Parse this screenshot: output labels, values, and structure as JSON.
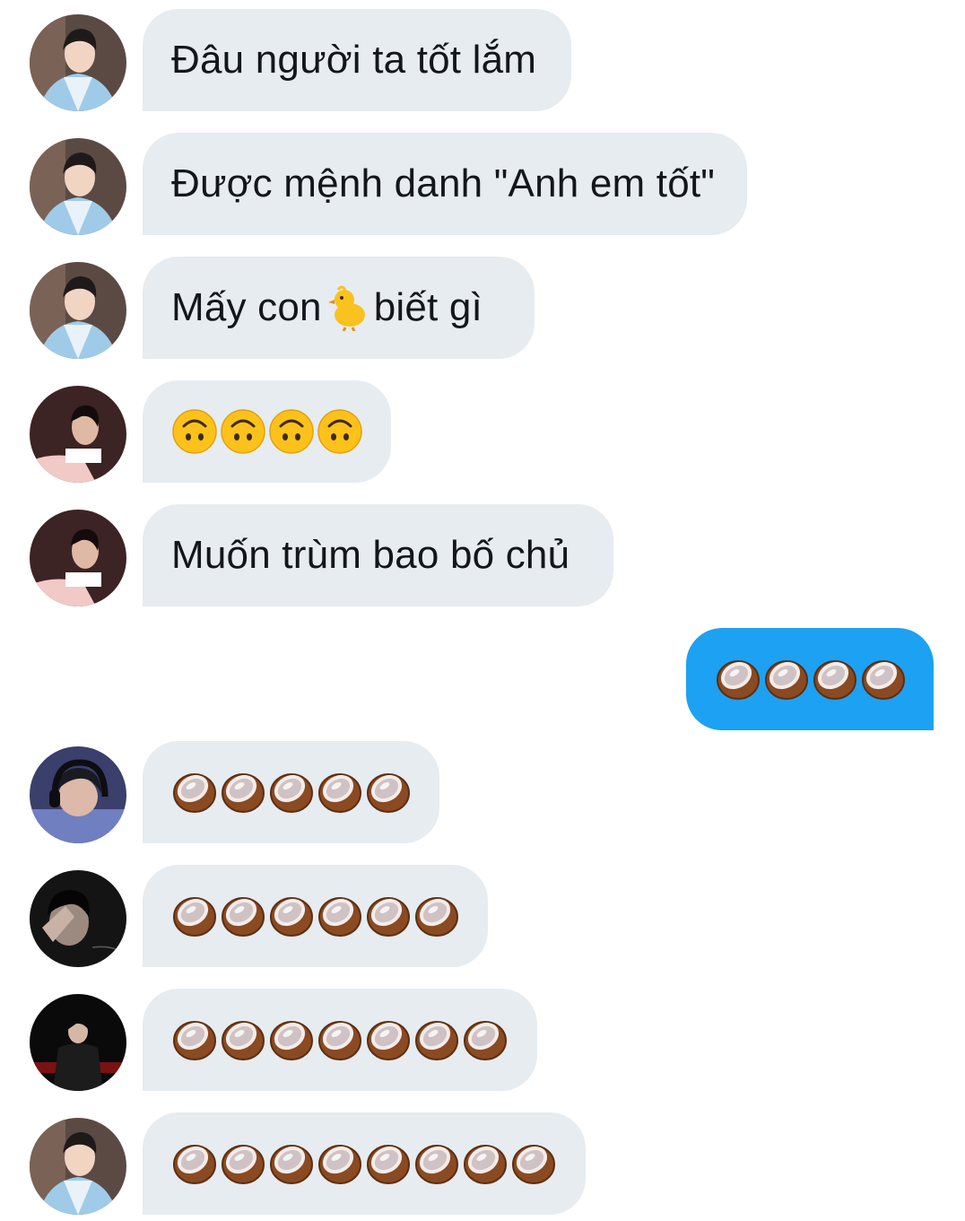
{
  "messages": [
    {
      "sender": "other",
      "avatar": "avatar-hanbok",
      "text": "Đâu người ta tốt lắm"
    },
    {
      "sender": "other",
      "avatar": "avatar-hanbok",
      "text": "Được mệnh danh \"Anh em tốt\""
    },
    {
      "sender": "other",
      "avatar": "avatar-hanbok",
      "text_before": "Mấy con",
      "emoji": "baby-chick",
      "text_after": "biết gì"
    },
    {
      "sender": "other",
      "avatar": "avatar-profile-pink",
      "emoji": "upside-down-face",
      "count": 4
    },
    {
      "sender": "other",
      "avatar": "avatar-profile-pink",
      "text": "Muốn trùm bao bố chủ"
    },
    {
      "sender": "me",
      "emoji": "coconut",
      "count": 4
    },
    {
      "sender": "other",
      "avatar": "avatar-headset",
      "emoji": "coconut",
      "count": 5
    },
    {
      "sender": "other",
      "avatar": "avatar-dark-hand",
      "emoji": "coconut",
      "count": 6
    },
    {
      "sender": "other",
      "avatar": "avatar-black-outfit",
      "emoji": "coconut",
      "count": 7
    },
    {
      "sender": "other",
      "avatar": "avatar-hanbok",
      "emoji": "coconut",
      "count": 8
    }
  ],
  "colors": {
    "incoming_bubble": "#e6ecf0",
    "outgoing_bubble": "#1da1f2",
    "incoming_text": "#14171a",
    "background": "#ffffff"
  }
}
